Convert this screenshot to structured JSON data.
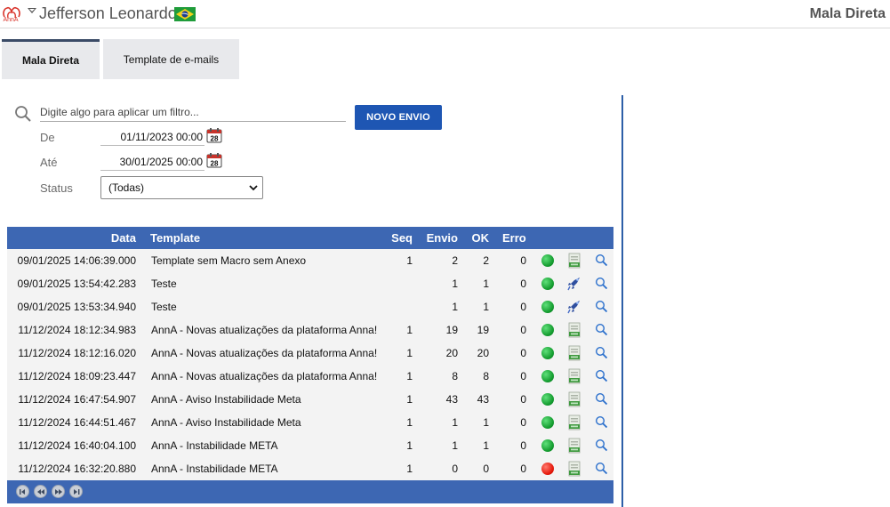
{
  "header": {
    "logo_text": "AnnA",
    "user_name": "Jefferson Leonardo",
    "page_title": "Mala Direta"
  },
  "tabs": [
    {
      "label": "Mala Direta",
      "active": true
    },
    {
      "label": "Template de e-mails",
      "active": false
    }
  ],
  "filter": {
    "placeholder": "Digite algo para aplicar um filtro...",
    "new_button": "NOVO ENVIO",
    "from_label": "De",
    "from_value": "01/11/2023 00:00",
    "to_label": "Até",
    "to_value": "30/01/2025 00:00",
    "status_label": "Status",
    "status_value": "(Todas)",
    "calendar_day": "28"
  },
  "grid": {
    "columns": {
      "data": "Data",
      "template": "Template",
      "seq": "Seq",
      "envio": "Envio",
      "ok": "OK",
      "erro": "Erro"
    },
    "rows": [
      {
        "data": "09/01/2025 14:06:39.000",
        "template": "Template sem Macro sem Anexo",
        "seq": "1",
        "envio": "2",
        "ok": "2",
        "erro": "0",
        "status": "green",
        "action": "xls-icon"
      },
      {
        "data": "09/01/2025 13:54:42.283",
        "template": "Teste",
        "seq": "",
        "envio": "1",
        "ok": "1",
        "erro": "0",
        "status": "green",
        "action": "rocket-icon"
      },
      {
        "data": "09/01/2025 13:53:34.940",
        "template": "Teste",
        "seq": "",
        "envio": "1",
        "ok": "1",
        "erro": "0",
        "status": "green",
        "action": "rocket-icon"
      },
      {
        "data": "11/12/2024 18:12:34.983",
        "template": "AnnA - Novas atualizações da plataforma Anna!",
        "seq": "1",
        "envio": "19",
        "ok": "19",
        "erro": "0",
        "status": "green",
        "action": "xls-icon"
      },
      {
        "data": "11/12/2024 18:12:16.020",
        "template": "AnnA - Novas atualizações da plataforma Anna!",
        "seq": "1",
        "envio": "20",
        "ok": "20",
        "erro": "0",
        "status": "green",
        "action": "xls-icon"
      },
      {
        "data": "11/12/2024 18:09:23.447",
        "template": "AnnA - Novas atualizações da plataforma Anna!",
        "seq": "1",
        "envio": "8",
        "ok": "8",
        "erro": "0",
        "status": "green",
        "action": "xls-icon"
      },
      {
        "data": "11/12/2024 16:47:54.907",
        "template": "AnnA - Aviso Instabilidade Meta",
        "seq": "1",
        "envio": "43",
        "ok": "43",
        "erro": "0",
        "status": "green",
        "action": "xls-icon"
      },
      {
        "data": "11/12/2024 16:44:51.467",
        "template": "AnnA - Aviso Instabilidade Meta",
        "seq": "1",
        "envio": "1",
        "ok": "1",
        "erro": "0",
        "status": "green",
        "action": "xls-icon"
      },
      {
        "data": "11/12/2024 16:40:04.100",
        "template": "AnnA - Instabilidade META",
        "seq": "1",
        "envio": "1",
        "ok": "1",
        "erro": "0",
        "status": "green",
        "action": "xls-icon"
      },
      {
        "data": "11/12/2024 16:32:20.880",
        "template": "AnnA - Instabilidade META",
        "seq": "1",
        "envio": "0",
        "ok": "0",
        "erro": "0",
        "status": "red",
        "action": "xls-icon"
      }
    ]
  },
  "colors": {
    "accent": "#1e56b3",
    "grid_header": "#3d67b3",
    "status_ok": "#139b2e",
    "status_error": "#e5170a"
  }
}
